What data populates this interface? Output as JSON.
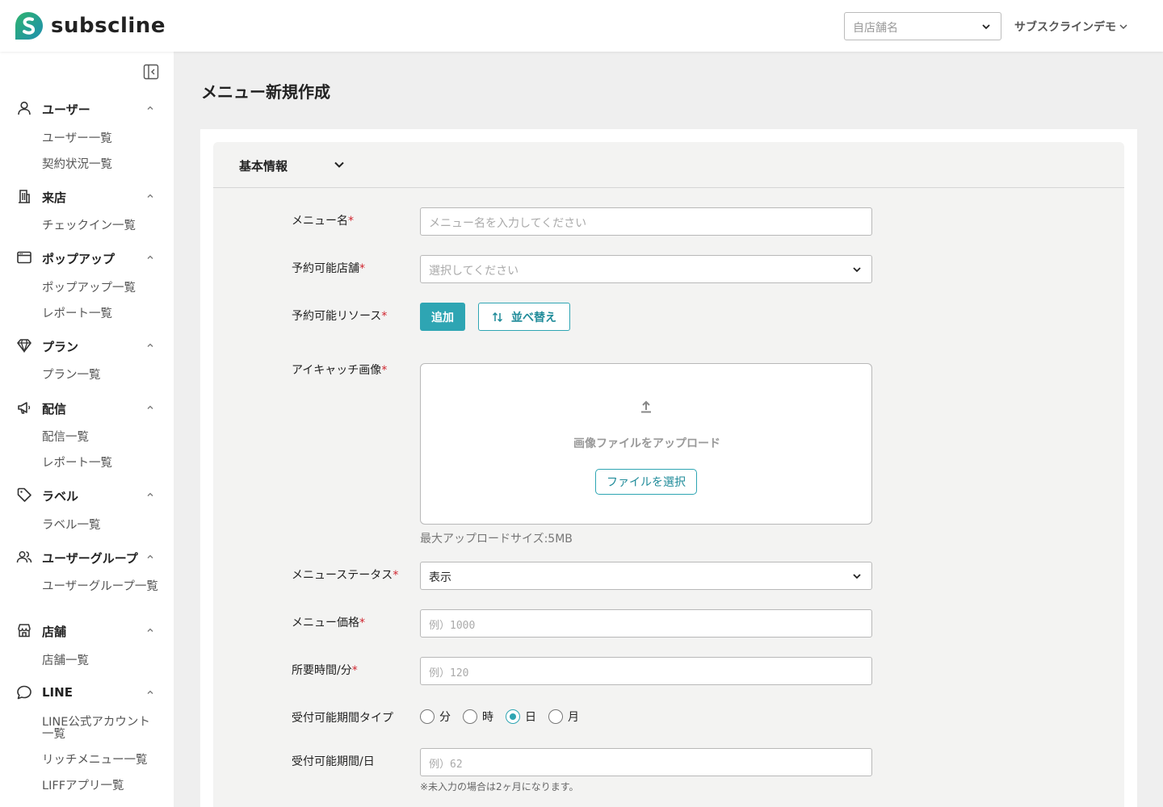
{
  "app": {
    "logo_text": "subscline"
  },
  "header": {
    "store_placeholder": "自店舗名",
    "account_name": "サブスクラインデモ"
  },
  "sidebar": {
    "groups": [
      {
        "label": "ユーザー",
        "icon": "user-icon",
        "items": [
          "ユーザー一覧",
          "契約状況一覧"
        ]
      },
      {
        "label": "来店",
        "icon": "building-icon",
        "items": [
          "チェックイン一覧"
        ]
      },
      {
        "label": "ポップアップ",
        "icon": "browser-window-icon",
        "items": [
          "ポップアップ一覧",
          "レポート一覧"
        ]
      },
      {
        "label": "プラン",
        "icon": "diamond-icon",
        "items": [
          "プラン一覧"
        ]
      },
      {
        "label": "配信",
        "icon": "megaphone-icon",
        "items": [
          "配信一覧",
          "レポート一覧"
        ]
      },
      {
        "label": "ラベル",
        "icon": "tag-icon",
        "items": [
          "ラベル一覧"
        ]
      },
      {
        "label": "ユーザーグループ",
        "icon": "users-icon",
        "items": [
          "ユーザーグループ一覧"
        ]
      },
      {
        "label": "店舗",
        "icon": "store-icon",
        "items": [
          "店舗一覧"
        ]
      },
      {
        "label": "LINE",
        "icon": "chat-bubble-icon",
        "items": [
          "LINE公式アカウント一覧",
          "リッチメニュー一覧",
          "LIFFアプリ一覧"
        ]
      }
    ]
  },
  "page": {
    "title": "メニュー新規作成"
  },
  "section": {
    "title": "基本情報"
  },
  "form": {
    "required_mark": "*",
    "menu_name": {
      "label": "メニュー名",
      "placeholder": "メニュー名を入力してください"
    },
    "store": {
      "label": "予約可能店舗",
      "placeholder": "選択してください"
    },
    "resource": {
      "label": "予約可能リソース",
      "add_label": "追加",
      "sort_label": "並べ替え"
    },
    "image": {
      "label": "アイキャッチ画像",
      "upload_text": "画像ファイルをアップロード",
      "select_label": "ファイルを選択",
      "max_size_hint": "最大アップロードサイズ:5MB"
    },
    "status": {
      "label": "メニューステータス",
      "value": "表示"
    },
    "price": {
      "label": "メニュー価格",
      "placeholder": "例）1000"
    },
    "duration": {
      "label": "所要時間/分",
      "placeholder": "例）120"
    },
    "period_type": {
      "label": "受付可能期間タイプ",
      "options": [
        "分",
        "時",
        "日",
        "月"
      ],
      "selected": "日"
    },
    "period_days": {
      "label": "受付可能期間/日",
      "placeholder": "例）62",
      "note": "※未入力の場合は2ヶ月になります。"
    }
  },
  "colors": {
    "accent": "#2ea5b3",
    "required": "#d0252f",
    "logo_green": "#2eb36e",
    "logo_teal": "#1f8fb0"
  }
}
